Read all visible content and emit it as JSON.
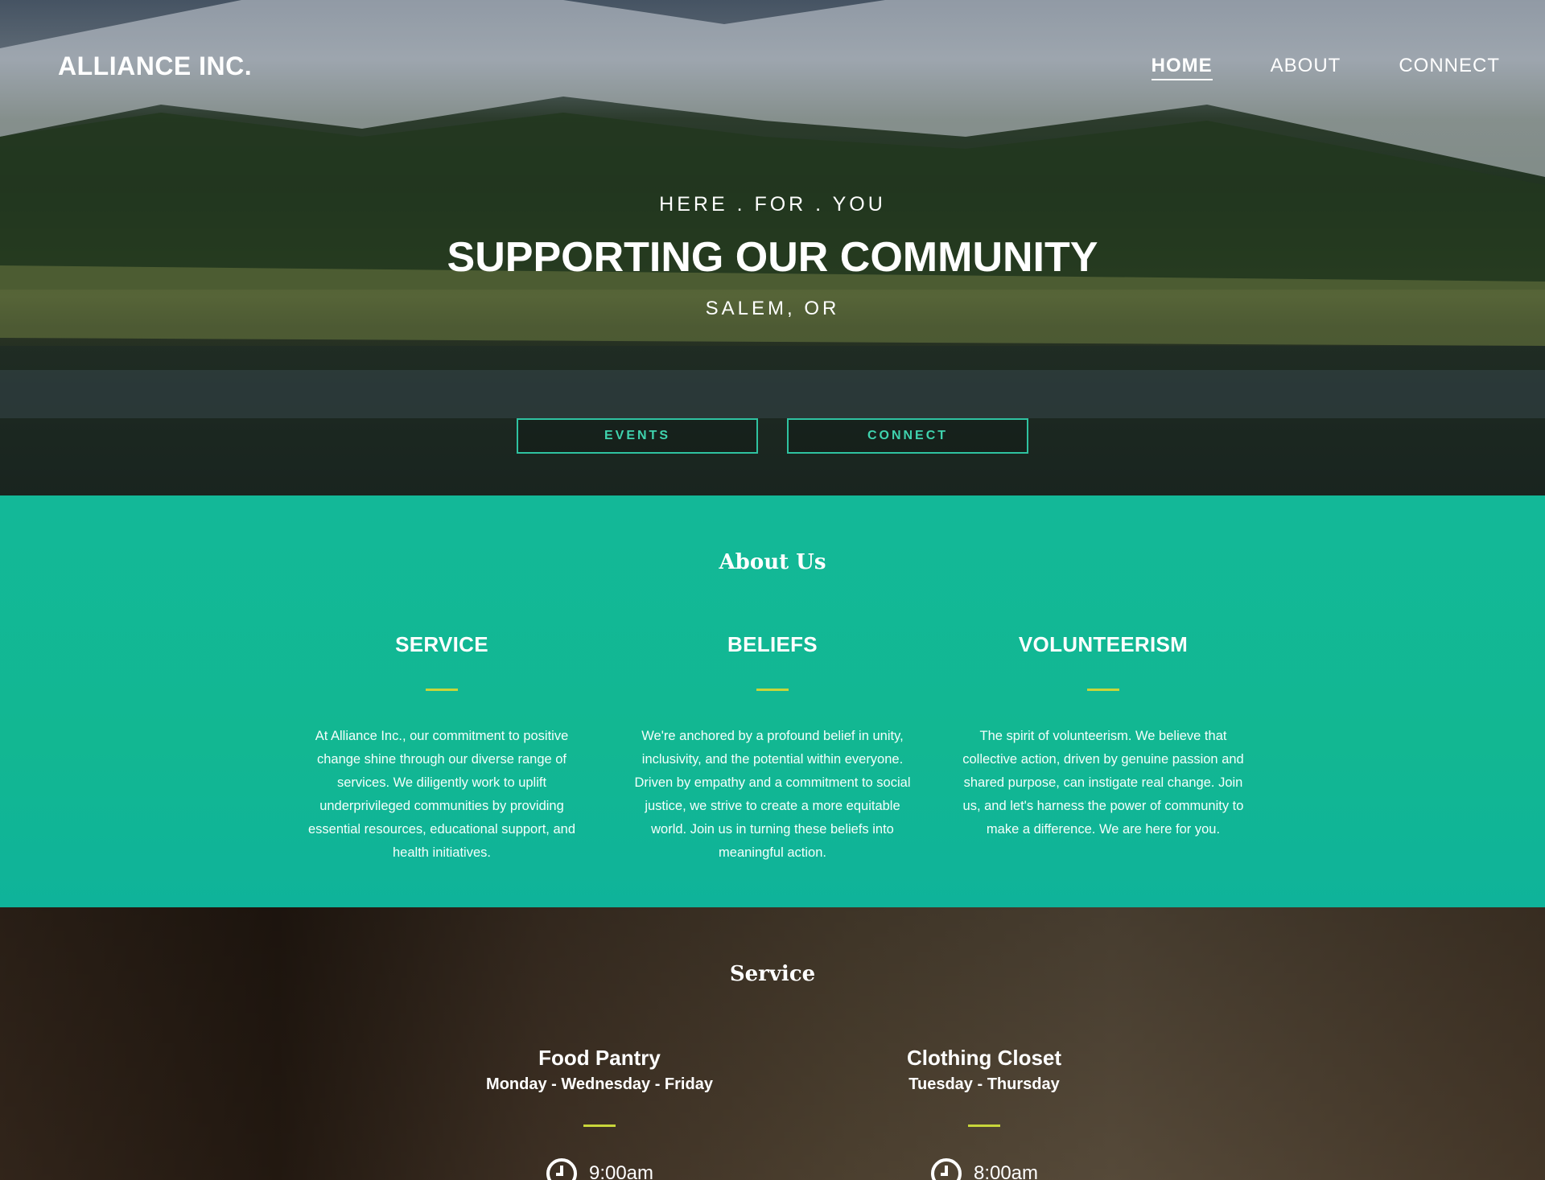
{
  "header": {
    "brand": "ALLIANCE INC.",
    "nav": [
      {
        "label": "HOME",
        "active": true
      },
      {
        "label": "ABOUT",
        "active": false
      },
      {
        "label": "CONNECT",
        "active": false
      }
    ]
  },
  "hero": {
    "kicker": "HERE . FOR . YOU",
    "title": "SUPPORTING OUR COMMUNITY",
    "location": "SALEM, OR",
    "buttons": {
      "events": "EVENTS",
      "connect": "CONNECT"
    },
    "accent_color": "#2fc2a0"
  },
  "about": {
    "title": "About Us",
    "columns": [
      {
        "heading": "SERVICE",
        "text": "At Alliance Inc., our commitment to positive change shine through our diverse range of services. We diligently work to uplift underprivileged communities by providing essential resources, educational support, and health initiatives."
      },
      {
        "heading": "BELIEFS",
        "text": "We're anchored by a profound belief in unity, inclusivity, and the potential within everyone. Driven by empathy and a commitment to social justice, we strive to create a more equitable world. Join us in turning these beliefs into meaningful action."
      },
      {
        "heading": "VOLUNTEERISM",
        "text": "The spirit of volunteerism. We believe that collective action, driven by genuine passion and shared purpose, can instigate real change. Join us, and let's harness the power of community to make a difference. We are here for you."
      }
    ],
    "background_color": "#12b792",
    "divider_color": "#c8d63a"
  },
  "service": {
    "title": "Service",
    "items": [
      {
        "name": "Food Pantry",
        "days": "Monday - Wednesday - Friday",
        "time": "9:00am",
        "icon": "clock-icon"
      },
      {
        "name": "Clothing Closet",
        "days": "Tuesday - Thursday",
        "time": "8:00am",
        "icon": "clock-icon"
      }
    ]
  }
}
